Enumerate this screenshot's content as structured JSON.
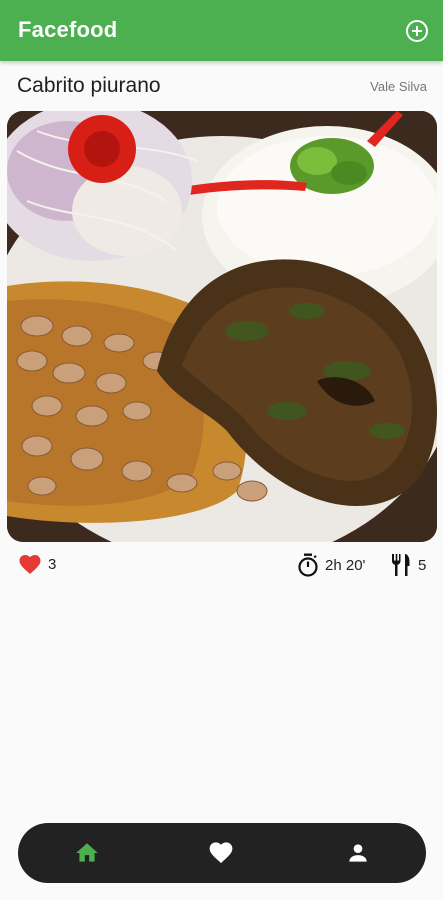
{
  "app": {
    "title": "Facefood"
  },
  "recipe": {
    "title": "Cabrito piurano",
    "author": "Vale Silva",
    "likes": "3",
    "time": "2h 20'",
    "servings": "5"
  },
  "icons": {
    "add": "add-circle-icon",
    "like": "heart-icon",
    "time": "timer-icon",
    "servings": "cutlery-icon",
    "home": "home-icon",
    "favorites": "heart-icon",
    "profile": "person-icon"
  },
  "colors": {
    "primary": "#4caf50",
    "like": "#e53935",
    "nav_background": "#222222",
    "nav_active": "#4caf50",
    "nav_inactive": "#ffffff"
  }
}
